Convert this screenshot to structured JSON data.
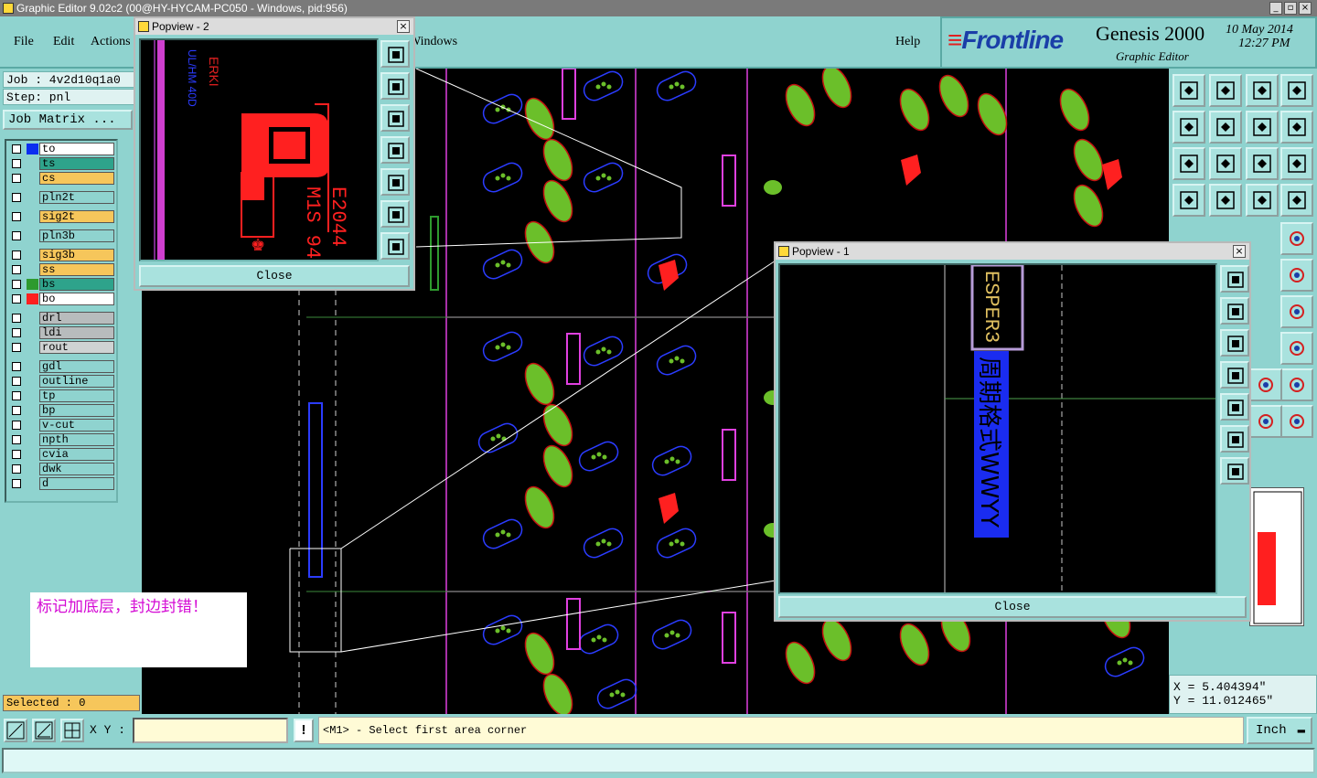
{
  "window": {
    "title": "Graphic Editor 9.02c2 (00@HY-HYCAM-PC050 - Windows, pid:956)"
  },
  "menu": {
    "file": "File",
    "edit": "Edit",
    "actions": "Actions",
    "windows": "Windows",
    "help": "Help"
  },
  "brand": {
    "logo": "Frontline",
    "product": "Genesis 2000",
    "subtitle": "Graphic Editor",
    "date": "10 May 2014",
    "time": "12:27 PM"
  },
  "job": {
    "job_label": "Job : 4v2d10q1a0",
    "step_label": "Step: pnl",
    "matrix_button": "Job Matrix ..."
  },
  "layers": [
    {
      "name": "to",
      "color": "#ffffff",
      "swatch": "#0b2ef0"
    },
    {
      "name": "ts",
      "color": "#2ea38b",
      "swatch": ""
    },
    {
      "name": "cs",
      "color": "#f6c65b",
      "swatch": ""
    },
    {
      "name": "pln2t",
      "color": "#8fd3cf",
      "swatch": ""
    },
    {
      "name": "sig2t",
      "color": "#f6c65b",
      "swatch": ""
    },
    {
      "name": "pln3b",
      "color": "#8fd3cf",
      "swatch": ""
    },
    {
      "name": "sig3b",
      "color": "#f6c65b",
      "swatch": ""
    },
    {
      "name": "ss",
      "color": "#f6c65b",
      "swatch": ""
    },
    {
      "name": "bs",
      "color": "#2ea38b",
      "swatch": "#2e9a2e"
    },
    {
      "name": "bo",
      "color": "#ffffff",
      "swatch": "#ff1f1f"
    },
    {
      "name": "drl",
      "color": "#b8bcbd",
      "swatch": ""
    },
    {
      "name": "ldi",
      "color": "#b8bcbd",
      "swatch": ""
    },
    {
      "name": "rout",
      "color": "#cfd3d3",
      "swatch": ""
    },
    {
      "name": "gdl",
      "color": "#8fd3cf",
      "swatch": ""
    },
    {
      "name": "outline",
      "color": "#8fd3cf",
      "swatch": ""
    },
    {
      "name": "tp",
      "color": "#8fd3cf",
      "swatch": ""
    },
    {
      "name": "bp",
      "color": "#8fd3cf",
      "swatch": ""
    },
    {
      "name": "v-cut",
      "color": "#8fd3cf",
      "swatch": ""
    },
    {
      "name": "npth",
      "color": "#8fd3cf",
      "swatch": ""
    },
    {
      "name": "cvia",
      "color": "#8fd3cf",
      "swatch": ""
    },
    {
      "name": "dwk",
      "color": "#8fd3cf",
      "swatch": ""
    },
    {
      "name": "d",
      "color": "#8fd3cf",
      "swatch": ""
    }
  ],
  "selected": "Selected : 0",
  "note": "标记加底层，封边封错！",
  "popview2": {
    "title": "Popview - 2",
    "close": "Close",
    "marking_line1": "E2044",
    "marking_line2": "M1S 94"
  },
  "popview1": {
    "title": "Popview - 1",
    "close": "Close",
    "marking_text": "周期格式WWYY"
  },
  "coords": {
    "x": "X = 5.404394\"",
    "y": "Y = 11.012465\""
  },
  "command": {
    "xy_label": "X Y :",
    "xy_value": "",
    "prompt": "<M1> - Select first area corner",
    "unit": "Inch",
    "excl": "!"
  },
  "colors": {
    "panel": "#8fd3cf",
    "canvas": "#000000",
    "pad_green": "#6bbf2a",
    "trace_blue": "#2b3cff",
    "magenta": "#e040e0",
    "red": "#ff2020"
  }
}
